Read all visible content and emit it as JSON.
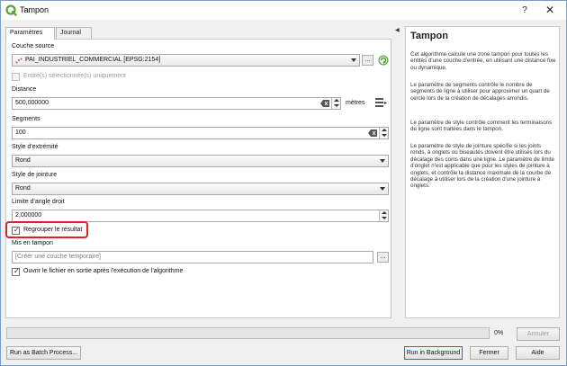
{
  "window": {
    "title": "Tampon",
    "help_glyph": "?",
    "close_glyph": "✕"
  },
  "tabs": {
    "params": "Paramètres",
    "journal": "Journal"
  },
  "form": {
    "input_layer_label": "Couche source",
    "input_layer_value": "PAI_INDUSTRIEL_COMMERCIAL [EPSG:2154]",
    "selected_only_label": "Entité(s) sélectionnée(s) uniquement",
    "distance_label": "Distance",
    "distance_value": "500,000000",
    "distance_unit": "mètres",
    "segments_label": "Segments",
    "segments_value": "100",
    "end_cap_label": "Style d'extrémité",
    "end_cap_value": "Rond",
    "join_style_label": "Style de jointure",
    "join_style_value": "Rond",
    "miter_label": "Limite d'angle droit",
    "miter_value": "2,000000",
    "dissolve_label": "Regrouper le résultat",
    "output_label": "Mis en tampon",
    "output_placeholder": "[Créer une couche temporaire]",
    "open_after_label": "Ouvrir le fichier en sortie après l'exécution de l'algorithme",
    "browse_label": "...",
    "arrow_left": "◀"
  },
  "help": {
    "title": "Tampon",
    "paragraphs": [
      "Cet algorithme calcule une zone tampon pour toutes les entités d'une couche d'entrée, en utilisant une distance fixe ou dynamique.",
      "Le paramètre de segments contrôle le nombre de segments de ligne à utiliser pour approximer un quart de cercle lors de la création de décalages arrondis.",
      "Le paramètre de style contrôle comment les terminaisons de ligne sont traitées dans le tampon.",
      "Le paramètre de style de jointure spécifie si les joints ronds, à onglets ou biseautés doivent être utilisés lors du décalage des coins dans une ligne. Le paramètre de limite d'onglet n'est applicable que pour les styles de jointure à onglets, et contrôle la distance maximale de la courbe de décalage à utiliser lors de la création d'une jointure à onglets."
    ]
  },
  "bottom": {
    "progress_text": "0%",
    "progress_value": 0,
    "cancel": "Annuler",
    "batch": "Run as Batch Process...",
    "run_bg": "Run in Background",
    "close": "Fermer",
    "help": "Aide"
  },
  "colors": {
    "highlight": "#e0202a",
    "qgis_green": "#5aa532"
  }
}
